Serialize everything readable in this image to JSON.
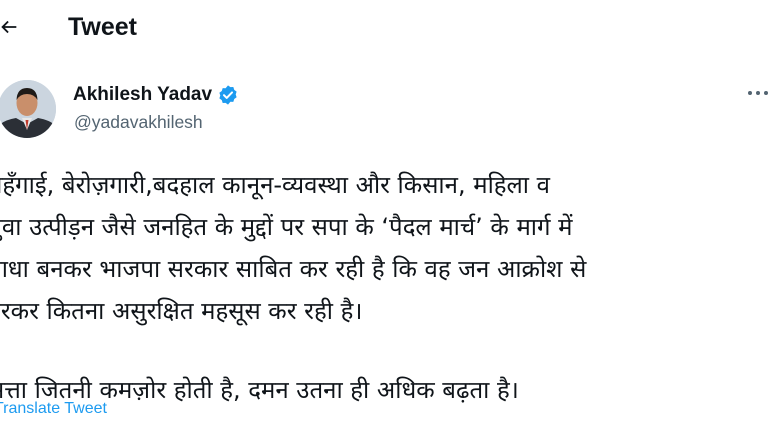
{
  "header": {
    "title": "Tweet",
    "back_icon": "back-arrow-icon"
  },
  "author": {
    "name": "Akhilesh Yadav",
    "handle": "@yadavakhilesh",
    "verified": true,
    "verified_color": "#1d9bf0"
  },
  "tweet": {
    "paragraph1_lines": [
      "महँगाई, बेरोज़गारी,बदहाल कानून-व्यवस्था और किसान, महिला व",
      "युवा उत्पीड़न जैसे जनहित के मुद्दों पर सपा के ‘पैदल मार्च’ के मार्ग में",
      "बाधा बनकर भाजपा सरकार साबित कर रही है कि वह जन आक्रोश से",
      "डरकर कितना असुरक्षित महसूस कर रही है।"
    ],
    "paragraph2": "सत्ता जितनी कमज़ोर होती है, दमन उतना ही अधिक बढ़ता है।"
  },
  "actions": {
    "translate": "Translate Tweet"
  },
  "colors": {
    "text": "#0f1419",
    "secondary": "#536471",
    "accent": "#1d9bf0"
  }
}
